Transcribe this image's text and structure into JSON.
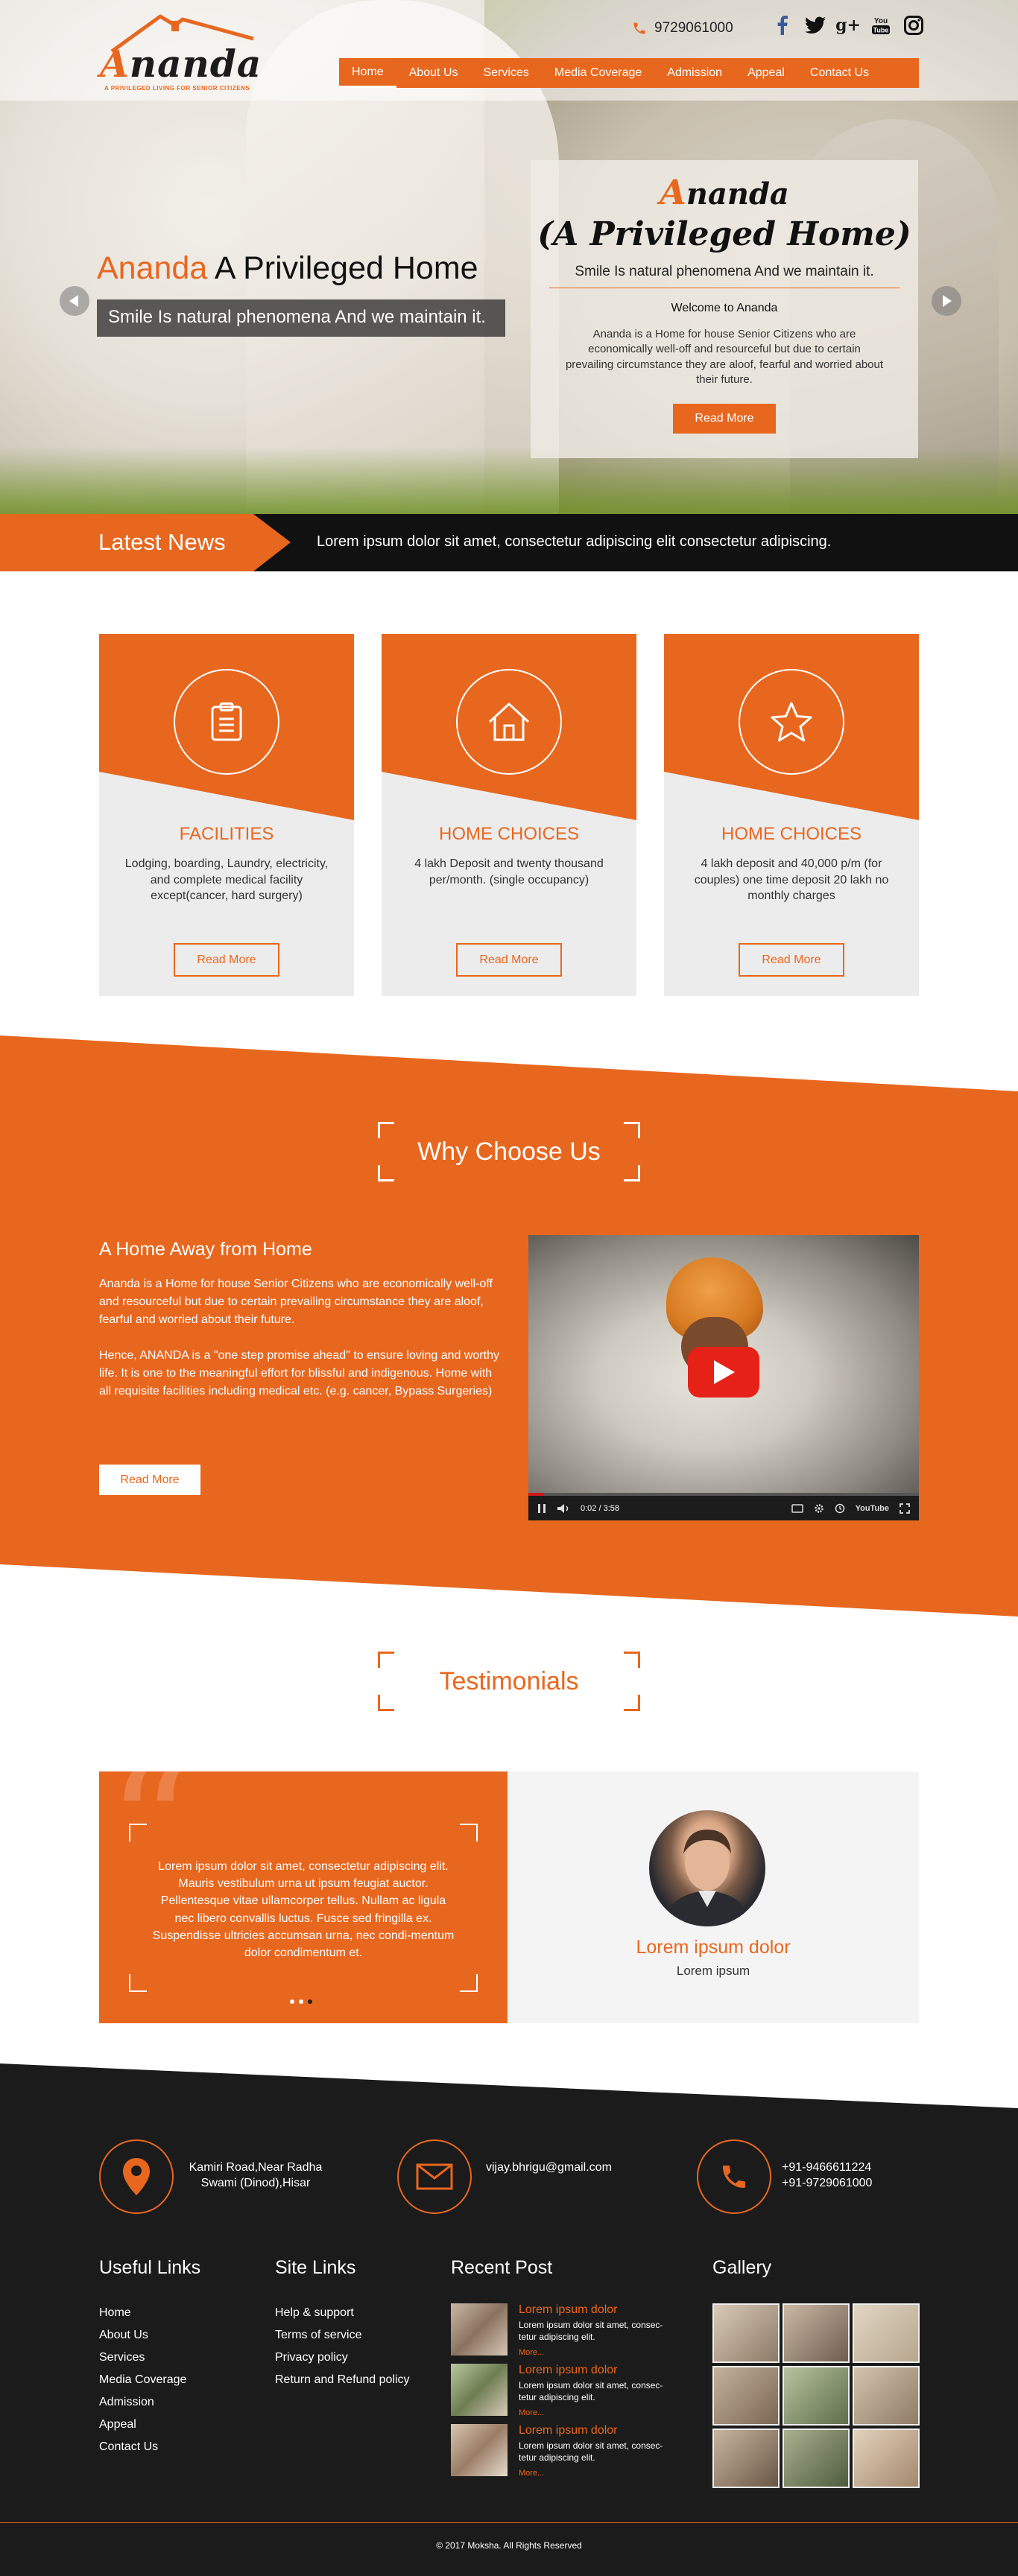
{
  "brand": {
    "logo_name_initial": "A",
    "logo_name_rest": "nanda",
    "logo_tagline": "A PRIVILEGED LIVING FOR SENIOR CITIZENS",
    "accent_color": "#e8671f",
    "dark_color": "#1b1b1b"
  },
  "header": {
    "phone": "9729061000",
    "social": [
      {
        "name": "facebook-icon",
        "label": "f"
      },
      {
        "name": "twitter-icon",
        "label": "t"
      },
      {
        "name": "google-plus-icon",
        "label": "g+"
      },
      {
        "name": "youtube-icon",
        "label": "You Tube"
      },
      {
        "name": "instagram-icon",
        "label": ""
      }
    ],
    "nav": [
      "Home",
      "About Us",
      "Services",
      "Media Coverage",
      "Admission",
      "Appeal",
      "Contact Us"
    ],
    "active_nav": "Home"
  },
  "hero": {
    "title_accent": "Ananda",
    "title_rest": " A Privileged Home",
    "subtitle": "Smile Is natural phenomena And we maintain it.",
    "card": {
      "title_initial": "A",
      "title_rest": "nanda",
      "title_line2": "(A Privileged Home)",
      "tagline": "Smile Is natural phenomena And we maintain it.",
      "welcome": "Welcome to Ananda",
      "body": "Ananda is a Home for house Senior Citizens who are economically well-off and resourceful but due to certain prevailing circumstance they are aloof, fearful and worried about their future.",
      "button": "Read More"
    }
  },
  "news": {
    "label": "Latest News",
    "ticker": "Lorem ipsum dolor sit amet, consectetur adipiscing elit consectetur adipiscing."
  },
  "services": [
    {
      "title": "FACILITIES",
      "desc": "Lodging, boarding, Laundry, electricity,  and complete medical facility except(cancer, hard surgery)",
      "button": "Read More",
      "icon": "clipboard-icon"
    },
    {
      "title": "HOME CHOICES",
      "desc": "4 lakh Deposit and twenty thousand per/month. (single occupancy)",
      "button": "Read More",
      "icon": "house-icon"
    },
    {
      "title": "HOME CHOICES",
      "desc": "4 lakh deposit and 40,000 p/m (for couples) one time deposit 20 lakh no monthly charges",
      "button": "Read More",
      "icon": "star-icon"
    }
  ],
  "why": {
    "heading": "Why Choose Us",
    "subheading": "A Home Away from Home",
    "para1": "Ananda is a Home for house Senior Citizens who are economically well-off and resourceful but due to certain prevailing circumstance they are aloof, fearful and worried about their future.",
    "para2": "Hence, ANANDA is a \"one step promise ahead\" to ensure loving and worthy life. It is one to the meaningful effort for blissful and indigenous. Home with all requisite facilities including medical etc. (e.g. cancer, Bypass Surgeries)",
    "button": "Read More",
    "video_time": "0:02 / 3:58",
    "video_progress": 0.04,
    "video_brand": "YouTube"
  },
  "testimonials": {
    "heading": "Testimonials",
    "quote": "Lorem ipsum dolor sit amet, consectetur adipiscing elit. Mauris vestibulum urna ut ipsum feugiat auctor. Pellentesque vitae ullamcorper tellus. Nullam ac ligula nec libero convallis luctus. Fusce sed fringilla ex. Suspendisse ultricies accumsan urna, nec condi-mentum dolor condimentum et.",
    "name": "Lorem ipsum dolor",
    "role": "Lorem ipsum",
    "active_dot": 3,
    "dot_count": 3
  },
  "footer": {
    "address": "Kamiri Road,Near Radha Swami (Dinod),Hisar",
    "email": "vijay.bhrigu@gmail.com",
    "phone1": "+91-9466611224",
    "phone2": "+91-9729061000",
    "useful_links_title": "Useful Links",
    "useful_links": [
      "Home",
      "About Us",
      "Services",
      "Media Coverage",
      "Admission",
      "Appeal",
      "Contact Us"
    ],
    "site_links_title": "Site Links",
    "site_links": [
      "Help & support",
      "Terms of service",
      "Privacy policy",
      "Return and Refund policy"
    ],
    "recent_post_title": "Recent Post",
    "posts": [
      {
        "title": "Lorem ipsum dolor",
        "desc": "Lorem ipsum dolor sit amet, consec-tetur adipiscing elit.",
        "more": "More..."
      },
      {
        "title": "Lorem ipsum dolor",
        "desc": "Lorem ipsum dolor sit amet, consec-tetur adipiscing elit.",
        "more": "More..."
      },
      {
        "title": "Lorem ipsum dolor",
        "desc": "Lorem ipsum dolor sit amet, consec-tetur adipiscing elit.",
        "more": "More..."
      }
    ],
    "gallery_title": "Gallery",
    "copyright": "© 2017 Moksha. All Rights Reserved"
  }
}
